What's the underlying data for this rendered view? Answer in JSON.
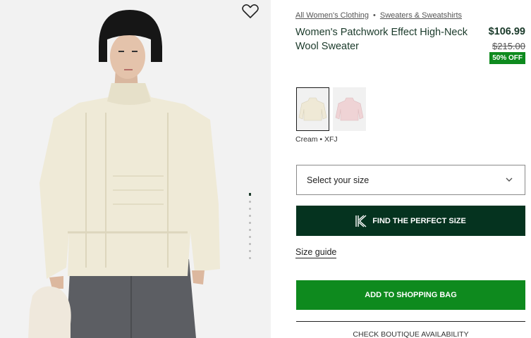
{
  "breadcrumb": {
    "items": [
      "All Women's Clothing",
      "Sweaters & Sweatshirts"
    ],
    "separator": "•"
  },
  "product": {
    "title": "Women's Patchwork Effect High-Neck Wool Sweater",
    "price": "$106.99",
    "old_price": "$215.00",
    "discount_badge": "50% OFF"
  },
  "colors": {
    "selected_label": "Cream • XFJ",
    "swatches": [
      {
        "name": "Cream",
        "hex": "#efe9d6",
        "selected": true
      },
      {
        "name": "Pink",
        "hex": "#efd3d5",
        "selected": false
      }
    ]
  },
  "size": {
    "placeholder": "Select your size"
  },
  "actions": {
    "find_size": "FIND THE PERFECT SIZE",
    "size_guide": "Size guide",
    "add_to_bag": "ADD TO SHOPPING BAG",
    "boutique": "CHECK BOUTIQUE AVAILABILITY"
  },
  "gallery": {
    "image_count": 10,
    "active_index": 0
  },
  "theme": {
    "dark_green": "#05331f",
    "green": "#0e8a1e",
    "text_green": "#1a3a2a"
  },
  "icons": {
    "wishlist": "heart-outline-icon",
    "dropdown": "chevron-down-icon",
    "fit": "k-logo-icon"
  }
}
